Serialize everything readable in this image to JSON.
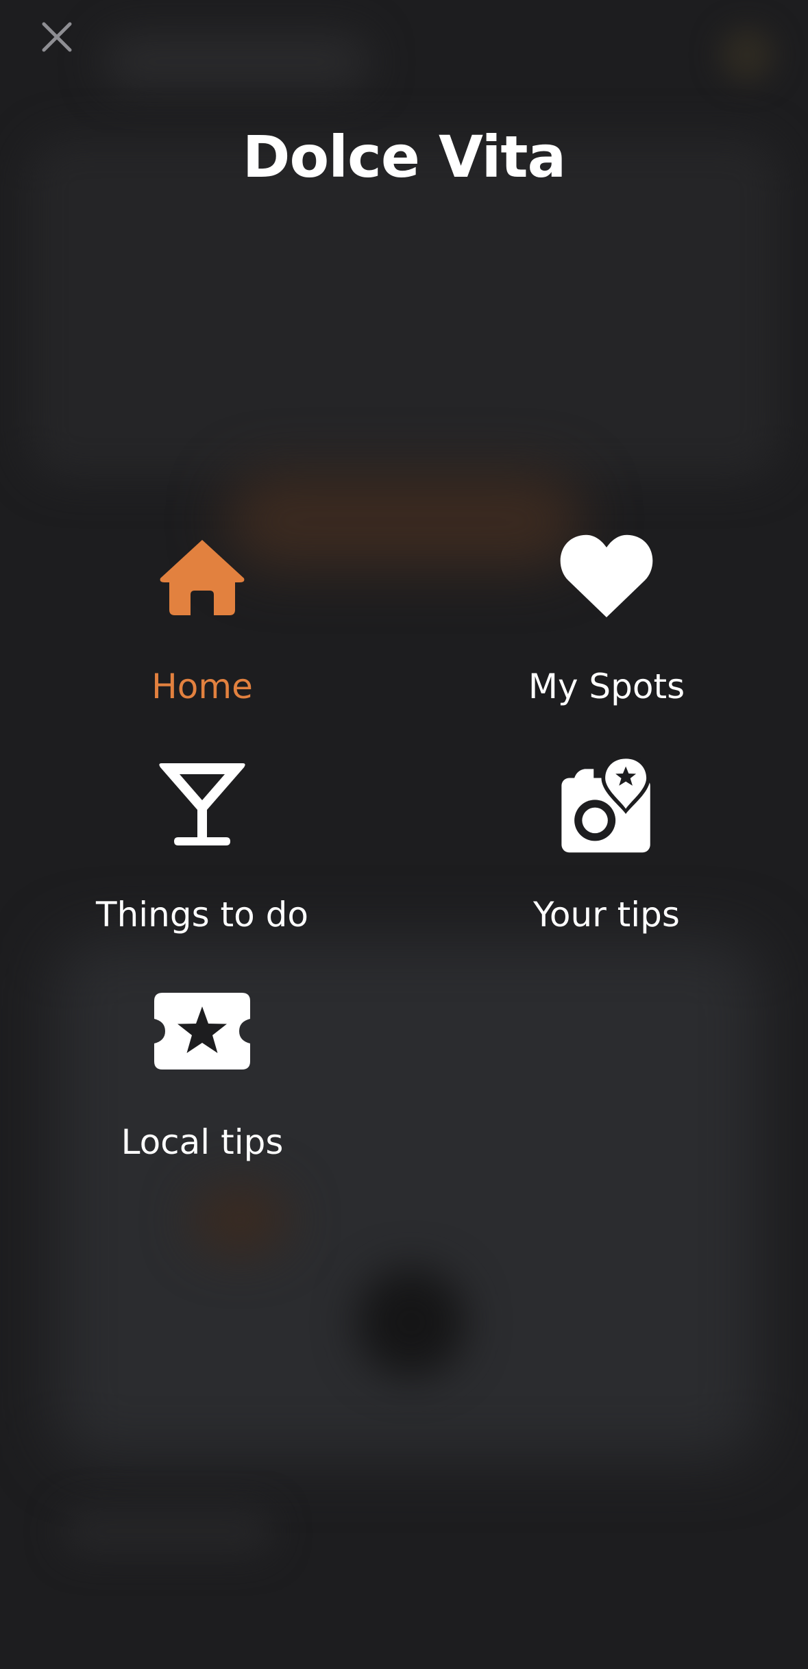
{
  "app": {
    "title": "Dolce Vita"
  },
  "menu": {
    "items": [
      {
        "id": "home",
        "label": "Home",
        "icon": "home-icon",
        "active": true
      },
      {
        "id": "my-spots",
        "label": "My Spots",
        "icon": "heart-icon",
        "active": false
      },
      {
        "id": "things-to-do",
        "label": "Things to do",
        "icon": "cocktail-icon",
        "active": false
      },
      {
        "id": "your-tips",
        "label": "Your tips",
        "icon": "camera-pin-icon",
        "active": false
      },
      {
        "id": "local-tips",
        "label": "Local tips",
        "icon": "ticket-star-icon",
        "active": false
      }
    ]
  },
  "colors": {
    "accent": "#e2813f",
    "background": "#1d1d1f",
    "text": "#ffffff",
    "close_icon": "#8e8e93"
  }
}
